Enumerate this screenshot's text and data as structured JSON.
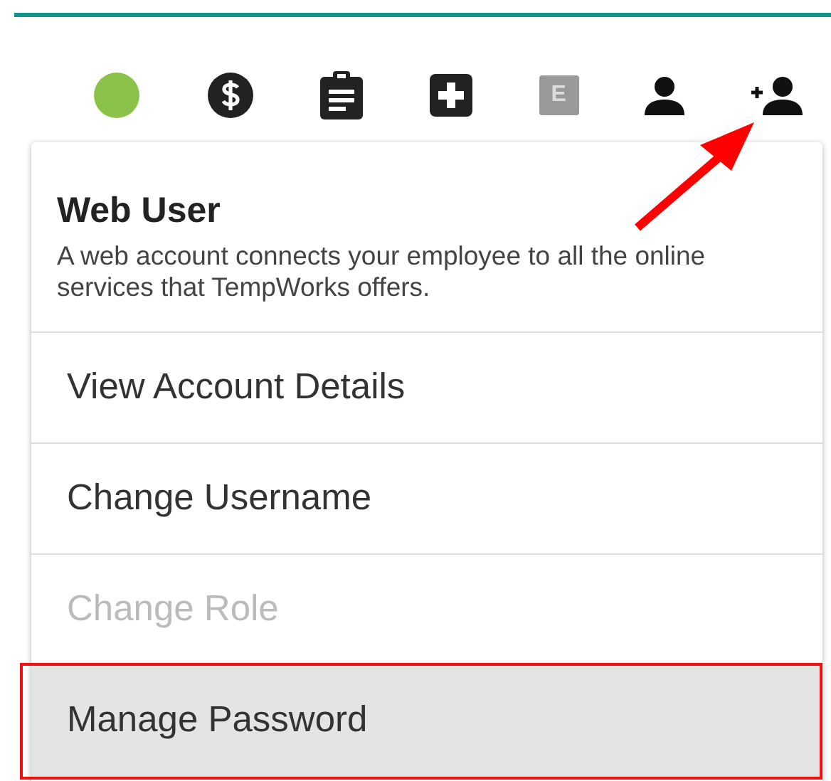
{
  "toolbar": [
    {
      "kind": "status",
      "color": "#8bc34a"
    },
    {
      "kind": "dollar"
    },
    {
      "kind": "clipboard"
    },
    {
      "kind": "plus"
    },
    {
      "kind": "letter",
      "label": "E"
    },
    {
      "kind": "person"
    },
    {
      "kind": "add-person"
    }
  ],
  "menu": {
    "title": "Web User",
    "description": "A web account connects your employee to all the online services that TempWorks offers.",
    "items": [
      {
        "label": "View Account Details",
        "disabled": false,
        "selected": false,
        "annotated": false
      },
      {
        "label": "Change Username",
        "disabled": false,
        "selected": false,
        "annotated": false
      },
      {
        "label": "Change Role",
        "disabled": true,
        "selected": false,
        "annotated": false
      },
      {
        "label": "Manage Password",
        "disabled": false,
        "selected": true,
        "annotated": true
      }
    ]
  }
}
